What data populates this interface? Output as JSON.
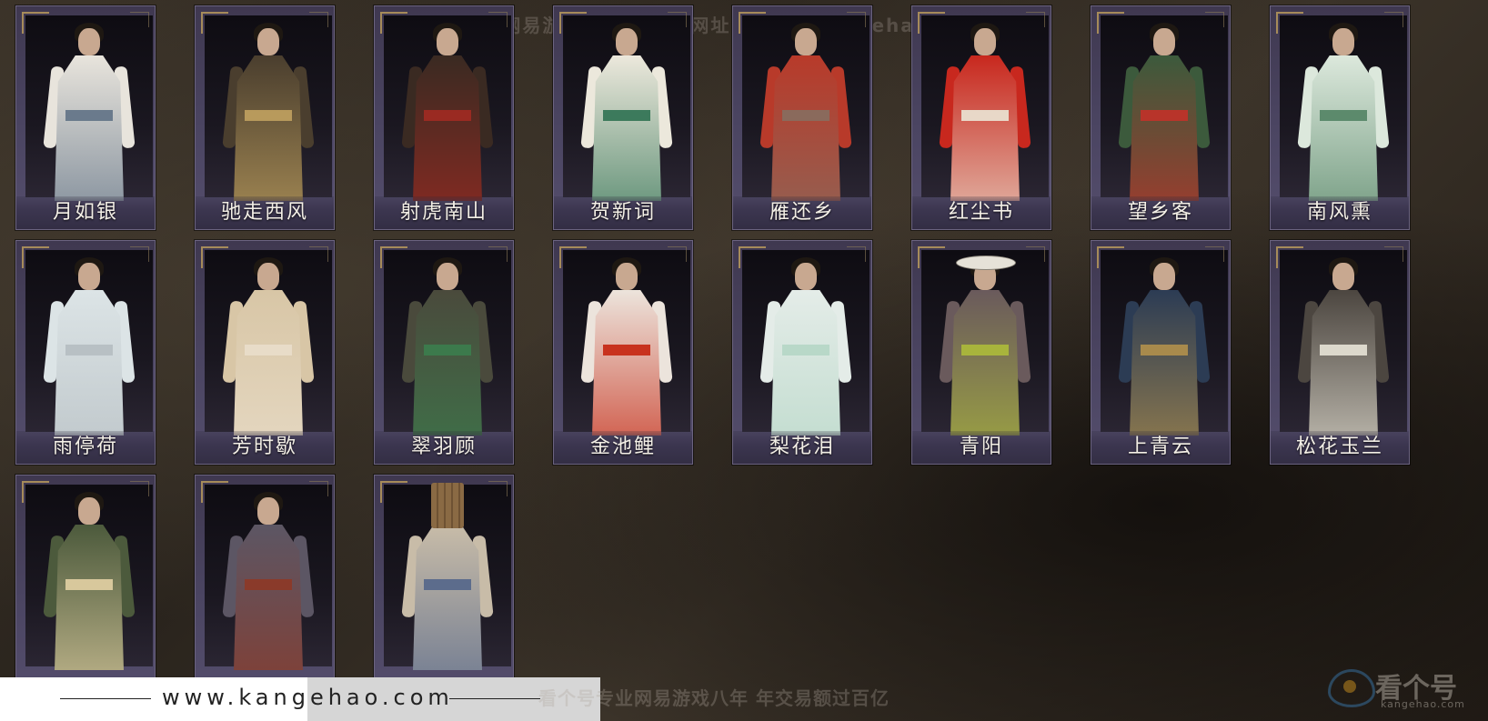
{
  "watermark_top": "网易游戏就选看个号  网址：www.kangehao.com",
  "characters": [
    {
      "name": "月如银",
      "robe": "#e8e4dc",
      "accent": "#6a7a8c"
    },
    {
      "name": "驰走西风",
      "robe": "#4a3e2e",
      "accent": "#b89a5c"
    },
    {
      "name": "射虎南山",
      "robe": "#3a2a22",
      "accent": "#9a2a22"
    },
    {
      "name": "贺新词",
      "robe": "#ece8dc",
      "accent": "#3c7a5c"
    },
    {
      "name": "雁还乡",
      "robe": "#b83a2a",
      "accent": "#8a6a5c"
    },
    {
      "name": "红尘书",
      "robe": "#c8281e",
      "accent": "#e8d8c8"
    },
    {
      "name": "望乡客",
      "robe": "#3c5a3c",
      "accent": "#b8342a"
    },
    {
      "name": "南风熏",
      "robe": "#dce8dc",
      "accent": "#5c8a6c"
    },
    {
      "name": "雨停荷",
      "robe": "#dce4e6",
      "accent": "#b8c0c4"
    },
    {
      "name": "芳时歇",
      "robe": "#d8c6a6",
      "accent": "#e8dcc8"
    },
    {
      "name": "翠羽顾",
      "robe": "#4a4a3c",
      "accent": "#3c7a4c"
    },
    {
      "name": "金池鲤",
      "robe": "#ece4dc",
      "accent": "#c8321e"
    },
    {
      "name": "梨花泪",
      "robe": "#e4ece8",
      "accent": "#b8d8c8"
    },
    {
      "name": "青阳",
      "robe": "#6a5a5c",
      "accent": "#a8b43c"
    },
    {
      "name": "上青云",
      "robe": "#2c3c54",
      "accent": "#a88a4c"
    },
    {
      "name": "松花玉兰",
      "robe": "#4c4640",
      "accent": "#dcd8cc"
    },
    {
      "name": "",
      "robe": "#4c5a3c",
      "accent": "#d8c89c"
    },
    {
      "name": "",
      "robe": "#5c5664",
      "accent": "#8a3a2a"
    },
    {
      "name": "",
      "robe": "#c8bca8",
      "accent": "#5c6c8c"
    }
  ],
  "bottom_url": "www.kangehao.com",
  "watermark_bottom": "看个号专业网易游戏八年   年交易额过百亿",
  "brand": {
    "name": "看个号",
    "sub": "kangehao.com"
  }
}
